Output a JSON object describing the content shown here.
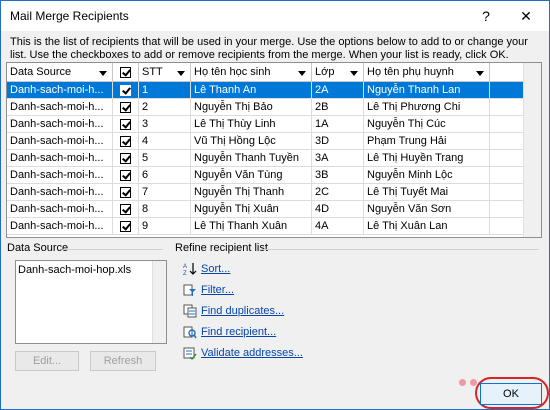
{
  "window": {
    "title": "Mail Merge Recipients",
    "help_label": "?",
    "close_label": "✕"
  },
  "intro": "This is the list of recipients that will be used in your merge.  Use the options below to add to or change your list.  Use the checkboxes to add or remove recipients from the merge.  When your list is ready, click OK.",
  "columns": {
    "data_source": "Data Source",
    "stt": "STT",
    "student": "Họ tên học sinh",
    "class": "Lớp",
    "parent": "Họ tên phụ huynh"
  },
  "rows": [
    {
      "source": "Danh-sach-moi-h...",
      "stt": "1",
      "student": "Lê Thanh An",
      "class": "2A",
      "parent": "Nguyễn Thanh Lan",
      "selected": true
    },
    {
      "source": "Danh-sach-moi-h...",
      "stt": "2",
      "student": "Nguyễn Thị Bảo",
      "class": "2B",
      "parent": "Lê Thị Phương Chi"
    },
    {
      "source": "Danh-sach-moi-h...",
      "stt": "3",
      "student": "Lê Thị Thùy Linh",
      "class": "1A",
      "parent": "Nguyễn Thị Cúc"
    },
    {
      "source": "Danh-sach-moi-h...",
      "stt": "4",
      "student": "Vũ Thị Hồng Lộc",
      "class": "3D",
      "parent": "Phạm Trung Hải"
    },
    {
      "source": "Danh-sach-moi-h...",
      "stt": "5",
      "student": "Nguyễn Thanh Tuyền",
      "class": "3A",
      "parent": "Lê Thị Huyền Trang"
    },
    {
      "source": "Danh-sach-moi-h...",
      "stt": "6",
      "student": "Nguyễn Văn Tùng",
      "class": "3B",
      "parent": "Nguyễn Minh Lộc"
    },
    {
      "source": "Danh-sach-moi-h...",
      "stt": "7",
      "student": "Nguyễn Thị Thanh",
      "class": "2C",
      "parent": "Lê Thị Tuyết Mai"
    },
    {
      "source": "Danh-sach-moi-h...",
      "stt": "8",
      "student": "Nguyễn Thị Xuân",
      "class": "4D",
      "parent": "Nguyễn Văn Sơn"
    },
    {
      "source": "Danh-sach-moi-h...",
      "stt": "9",
      "student": "Lê Thị Thanh Xuân",
      "class": "4A",
      "parent": "Lê Thị Xuân Lan"
    }
  ],
  "data_source_panel": {
    "label": "Data Source",
    "file": "Danh-sach-moi-hop.xls",
    "edit_label": "Edit...",
    "refresh_label": "Refresh"
  },
  "refine": {
    "label": "Refine recipient list",
    "items": [
      {
        "label": "Sort...",
        "icon": "sort-icon"
      },
      {
        "label": "Filter...",
        "icon": "filter-icon"
      },
      {
        "label": "Find duplicates...",
        "icon": "duplicates-icon"
      },
      {
        "label": "Find recipient...",
        "icon": "find-icon"
      },
      {
        "label": "Validate addresses...",
        "icon": "validate-icon"
      }
    ]
  },
  "ok_label": "OK",
  "colors": {
    "selection": "#0078d7",
    "link": "#0645ad",
    "highlight_ring": "#dd2222"
  }
}
